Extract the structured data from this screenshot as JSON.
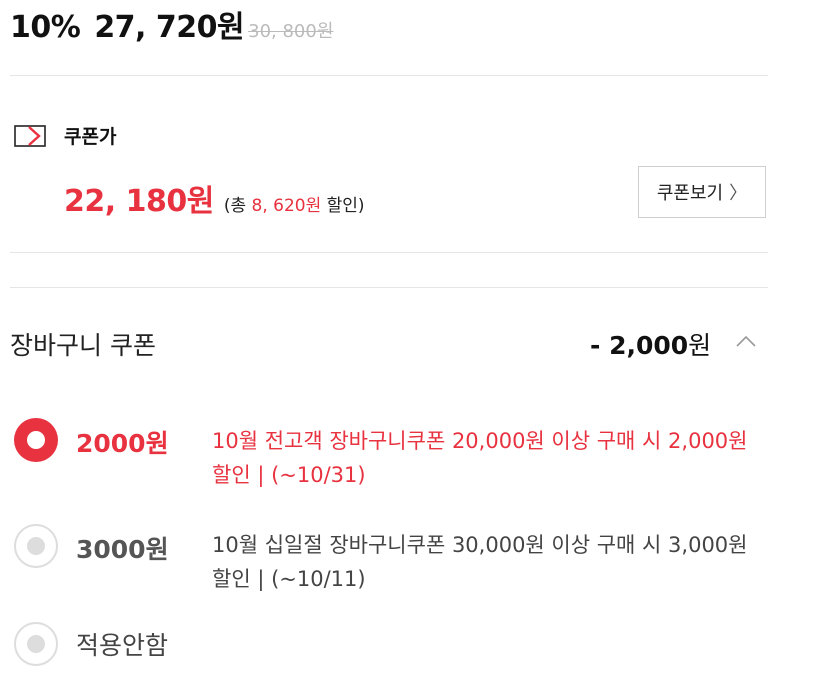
{
  "price": {
    "discount_rate": "10%",
    "sale_price": "27, 720원",
    "original_price": "30, 800원"
  },
  "coupon_price": {
    "icon": "coupon-tag-icon",
    "title": "쿠폰가",
    "price": "22, 180원",
    "discount_prefix": "(총 ",
    "discount_amount": "8, 620원",
    "discount_suffix": " 할인)",
    "view_button_label": "쿠폰보기",
    "view_button_chevron": "〉"
  },
  "cart_coupon": {
    "label": "장바구니 쿠폰",
    "amount_number": "- 2,000",
    "amount_unit": "원",
    "options": [
      {
        "amount": "2000원",
        "description": "10월 전고객 장바구니쿠폰 20,000원 이상 구매 시 2,000원 할인 | (~10/31)",
        "selected": true
      },
      {
        "amount": "3000원",
        "description": "10월 십일절 장바구니쿠폰 30,000원 이상 구매 시 3,000원 할인 | (~10/11)",
        "selected": false
      },
      {
        "label": "적용안함",
        "selected": false
      }
    ]
  },
  "colors": {
    "accent": "#e8323f",
    "divider": "#e6e6e6",
    "muted": "#bbbbbb"
  }
}
